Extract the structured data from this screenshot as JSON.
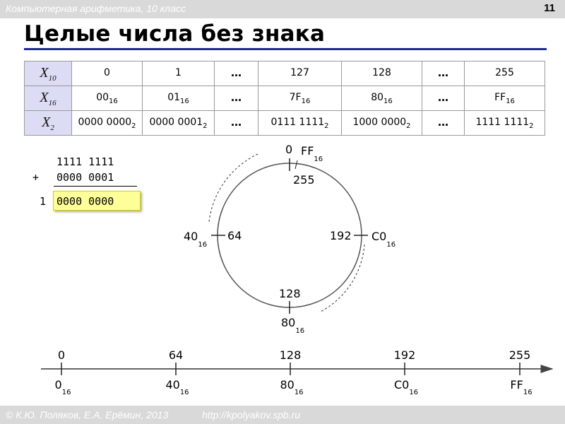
{
  "header": {
    "course": "Компьютерная арифметика, 10 класс",
    "slide_number": "11"
  },
  "title": "Целые числа без знака",
  "table": {
    "rows": [
      {
        "head": "X",
        "head_sub": "10",
        "cells": [
          {
            "v": "0",
            "s": ""
          },
          {
            "v": "1",
            "s": ""
          },
          {
            "v": "…",
            "s": ""
          },
          {
            "v": "127",
            "s": ""
          },
          {
            "v": "128",
            "s": ""
          },
          {
            "v": "…",
            "s": ""
          },
          {
            "v": "255",
            "s": ""
          }
        ]
      },
      {
        "head": "X",
        "head_sub": "16",
        "cells": [
          {
            "v": "00",
            "s": "16"
          },
          {
            "v": "01",
            "s": "16"
          },
          {
            "v": "…",
            "s": ""
          },
          {
            "v": "7F",
            "s": "16"
          },
          {
            "v": "80",
            "s": "16"
          },
          {
            "v": "…",
            "s": ""
          },
          {
            "v": "FF",
            "s": "16"
          }
        ]
      },
      {
        "head": "X",
        "head_sub": "2",
        "cells": [
          {
            "v": "0000 0000",
            "s": "2"
          },
          {
            "v": "0000 0001",
            "s": "2"
          },
          {
            "v": "…",
            "s": ""
          },
          {
            "v": "0111 1111",
            "s": "2"
          },
          {
            "v": "1000 0000",
            "s": "2"
          },
          {
            "v": "…",
            "s": ""
          },
          {
            "v": "1111 1111",
            "s": "2"
          }
        ]
      }
    ]
  },
  "addition": {
    "line1": "1111 1111",
    "line2": "0000 0001",
    "plus": "+",
    "carry": "1",
    "result": "0000 0000"
  },
  "circle": {
    "top_outer": "0",
    "top_hex": "FF",
    "top_hex_sub": "16",
    "top_inner": "255",
    "left_outer": "40",
    "left_outer_sub": "16",
    "left_inner": "64",
    "right_inner": "192",
    "right_outer": "C0",
    "right_outer_sub": "16",
    "bottom_inner": "128",
    "bottom_outer": "80",
    "bottom_outer_sub": "16"
  },
  "number_line": {
    "ticks": [
      {
        "dec": "0",
        "hex": "0",
        "sub": "16"
      },
      {
        "dec": "64",
        "hex": "40",
        "sub": "16"
      },
      {
        "dec": "128",
        "hex": "80",
        "sub": "16"
      },
      {
        "dec": "192",
        "hex": "C0",
        "sub": "16"
      },
      {
        "dec": "255",
        "hex": "FF",
        "sub": "16"
      }
    ]
  },
  "footer": {
    "authors": "© К.Ю. Поляков, Е.А. Ерёмин, 2013",
    "url": "http://kpolyakov.spb.ru"
  },
  "colors": {
    "bar": "#d9d9d9",
    "rule": "#1f2b8f",
    "rowhead": "#dcdcf4",
    "highlight": "#ffff99"
  }
}
